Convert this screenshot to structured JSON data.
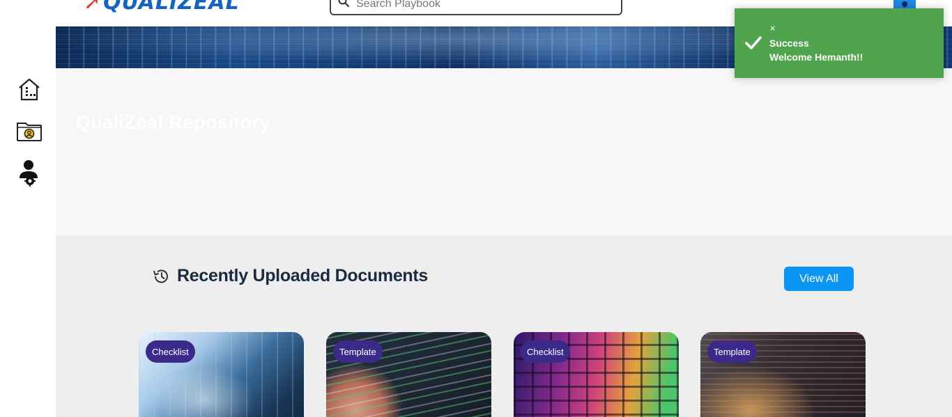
{
  "header": {
    "logo_text": "QUALIZEAL",
    "search_placeholder": "Search Playbook"
  },
  "sidebar": {
    "items": [
      {
        "icon": "home-icon"
      },
      {
        "icon": "folder-user-icon"
      },
      {
        "icon": "user-settings-icon"
      }
    ]
  },
  "hero": {
    "title": "QualiZeal Repository"
  },
  "recent": {
    "title": "Recently Uploaded Documents",
    "view_all_label": "View All",
    "cards": [
      {
        "badge": "Checklist"
      },
      {
        "badge": "Template"
      },
      {
        "badge": "Checklist"
      },
      {
        "badge": "Template"
      }
    ]
  },
  "toast": {
    "close_glyph": "⨯",
    "title": "Success",
    "message": "Welcome Hemanth!!"
  },
  "colors": {
    "accent": "#0b95f5",
    "toast_success": "#4fa44d",
    "badge": "#3b2a8a",
    "heading": "#1b2b3d"
  }
}
